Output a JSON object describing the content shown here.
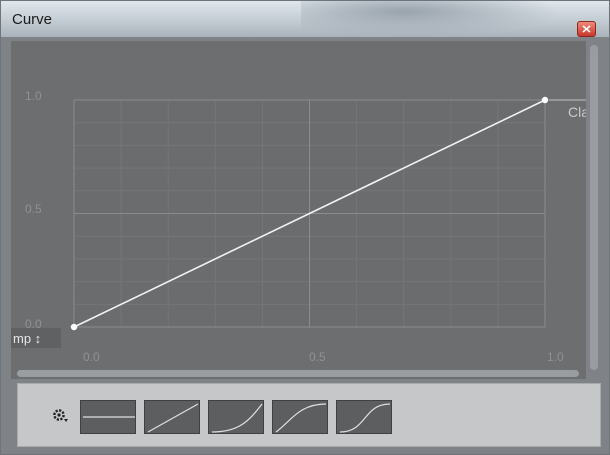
{
  "window": {
    "title": "Curve",
    "close_label": "close"
  },
  "graph": {
    "y_ticks": [
      "1.0",
      "0.5",
      "0.0"
    ],
    "x_ticks": [
      "0.0",
      "0.5",
      "1.0"
    ],
    "left_label": "mp ↕",
    "right_label": "Clan",
    "points": [
      {
        "x": 0.0,
        "y": 0.0
      },
      {
        "x": 1.0,
        "y": 1.0
      }
    ]
  },
  "toolbar": {
    "gear_icon": "gear-icon",
    "presets": [
      "flat",
      "linear",
      "ease-in",
      "ease-out",
      "s-curve"
    ]
  },
  "colors": {
    "panel": "#6c6e70",
    "curve": "#ffffff",
    "grid": "#7a7c7f",
    "bottom": "#c5c7c9"
  }
}
